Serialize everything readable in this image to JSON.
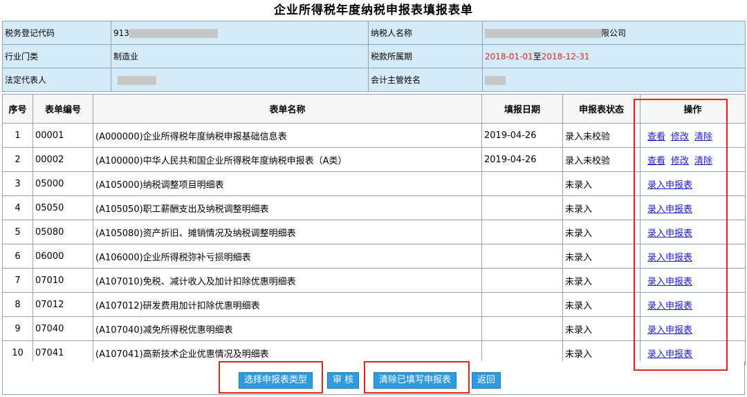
{
  "title": "企业所得税年度纳税申报表填报表单",
  "info": {
    "tax_id_label": "税务登记代码",
    "tax_id_value": "913",
    "taxpayer_name_label": "纳税人名称",
    "taxpayer_name_value": "限公司",
    "industry_label": "行业门类",
    "industry_value": "制造业",
    "period_label": "税款所属期",
    "period_start": "2018-01-01",
    "period_sep": "至",
    "period_end": "2018-12-31",
    "legal_rep_label": "法定代表人",
    "accountant_label": "会计主管姓名"
  },
  "table": {
    "headers": [
      "序号",
      "表单编号",
      "表单名称",
      "填报日期",
      "申报表状态",
      "操作"
    ],
    "rows": [
      {
        "no": "1",
        "code": "00001",
        "name": "(A000000)企业所得税年度纳税申报基础信息表",
        "date": "2019-04-26",
        "status": "录入未校验",
        "actions": [
          "查看",
          "修改",
          "清除"
        ]
      },
      {
        "no": "2",
        "code": "00002",
        "name": "(A100000)中华人民共和国企业所得税年度纳税申报表（A类）",
        "date": "2019-04-26",
        "status": "录入未校验",
        "actions": [
          "查看",
          "修改",
          "清除"
        ]
      },
      {
        "no": "3",
        "code": "05000",
        "name": "(A105000)纳税调整项目明细表",
        "date": "",
        "status": "未录入",
        "actions": [
          "录入申报表"
        ]
      },
      {
        "no": "4",
        "code": "05050",
        "name": "(A105050)职工薪酬支出及纳税调整明细表",
        "date": "",
        "status": "未录入",
        "actions": [
          "录入申报表"
        ]
      },
      {
        "no": "5",
        "code": "05080",
        "name": "(A105080)资产折旧、摊销情况及纳税调整明细表",
        "date": "",
        "status": "未录入",
        "actions": [
          "录入申报表"
        ]
      },
      {
        "no": "6",
        "code": "06000",
        "name": "(A106000)企业所得税弥补亏损明细表",
        "date": "",
        "status": "未录入",
        "actions": [
          "录入申报表"
        ]
      },
      {
        "no": "7",
        "code": "07010",
        "name": "(A107010)免税、减计收入及加计扣除优惠明细表",
        "date": "",
        "status": "未录入",
        "actions": [
          "录入申报表"
        ]
      },
      {
        "no": "8",
        "code": "07012",
        "name": "(A107012)研发费用加计扣除优惠明细表",
        "date": "",
        "status": "未录入",
        "actions": [
          "录入申报表"
        ]
      },
      {
        "no": "9",
        "code": "07040",
        "name": "(A107040)减免所得税优惠明细表",
        "date": "",
        "status": "未录入",
        "actions": [
          "录入申报表"
        ]
      },
      {
        "no": "10",
        "code": "07041",
        "name": "(A107041)高新技术企业优惠情况及明细表",
        "date": "",
        "status": "未录入",
        "actions": [
          "录入申报表"
        ]
      }
    ]
  },
  "buttons": {
    "select_type": "选择申报表类型",
    "audit": "审 核",
    "clear_filled": "清除已填写申报表",
    "back": "返回"
  },
  "colors": {
    "button_bg": "#2e9be0",
    "highlight_red": "#e0241a",
    "link_blue": "#1a1ad0",
    "info_bg": "#d6ebf8"
  }
}
